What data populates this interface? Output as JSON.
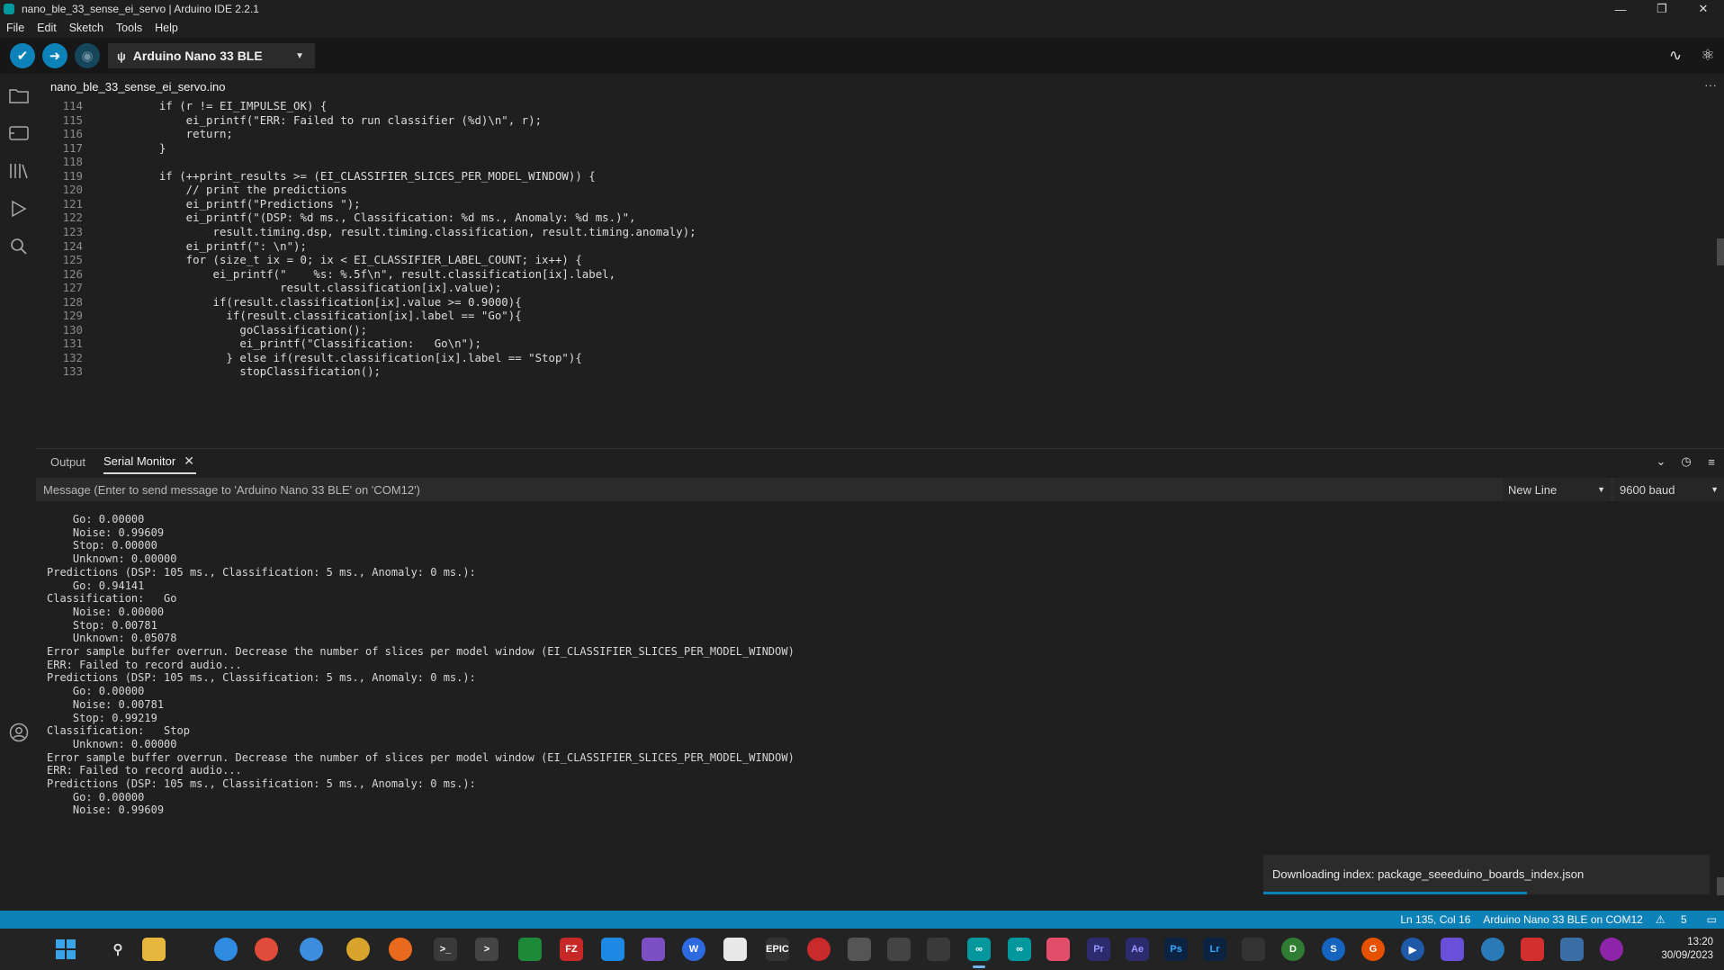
{
  "window": {
    "title": "nano_ble_33_sense_ei_servo | Arduino IDE 2.2.1",
    "controls": [
      "minimize",
      "restore",
      "close"
    ]
  },
  "menu": [
    "File",
    "Edit",
    "Sketch",
    "Tools",
    "Help"
  ],
  "toolbar": {
    "board": "Arduino Nano 33 BLE",
    "buttons": [
      "verify",
      "upload",
      "debug"
    ],
    "right_icons": [
      "serial-plotter",
      "serial-monitor"
    ]
  },
  "sidebar_icons": [
    "sketchbook",
    "boards-manager",
    "library-manager",
    "debug",
    "search",
    "account"
  ],
  "editor": {
    "tab": "nano_ble_33_sense_ei_servo.ino",
    "lines": [
      {
        "n": "114",
        "code": "    if (r != EI_IMPULSE_OK) {"
      },
      {
        "n": "115",
        "code": "        ei_printf(\"ERR: Failed to run classifier (%d)\\n\", r);"
      },
      {
        "n": "116",
        "code": "        return;"
      },
      {
        "n": "117",
        "code": "    }"
      },
      {
        "n": "118",
        "code": ""
      },
      {
        "n": "119",
        "code": "    if (++print_results >= (EI_CLASSIFIER_SLICES_PER_MODEL_WINDOW)) {"
      },
      {
        "n": "120",
        "code": "        // print the predictions"
      },
      {
        "n": "121",
        "code": "        ei_printf(\"Predictions \");"
      },
      {
        "n": "122",
        "code": "        ei_printf(\"(DSP: %d ms., Classification: %d ms., Anomaly: %d ms.)\","
      },
      {
        "n": "123",
        "code": "            result.timing.dsp, result.timing.classification, result.timing.anomaly);"
      },
      {
        "n": "124",
        "code": "        ei_printf(\": \\n\");"
      },
      {
        "n": "125",
        "code": "        for (size_t ix = 0; ix < EI_CLASSIFIER_LABEL_COUNT; ix++) {"
      },
      {
        "n": "126",
        "code": "            ei_printf(\"    %s: %.5f\\n\", result.classification[ix].label,"
      },
      {
        "n": "127",
        "code": "                      result.classification[ix].value);"
      },
      {
        "n": "128",
        "code": "            if(result.classification[ix].value >= 0.9000){"
      },
      {
        "n": "129",
        "code": "              if(result.classification[ix].label == \"Go\"){"
      },
      {
        "n": "130",
        "code": "                goClassification();"
      },
      {
        "n": "131",
        "code": "                ei_printf(\"Classification:   Go\\n\");"
      },
      {
        "n": "132",
        "code": "              } else if(result.classification[ix].label == \"Stop\"){"
      },
      {
        "n": "133",
        "code": "                stopClassification();"
      }
    ]
  },
  "panel": {
    "tabs": [
      "Output",
      "Serial Monitor"
    ],
    "active_tab": "Serial Monitor",
    "message_placeholder": "Message (Enter to send message to 'Arduino Nano 33 BLE' on 'COM12')",
    "line_ending": "New Line",
    "baud": "9600 baud",
    "serial_lines": [
      "    Go: 0.00000",
      "    Noise: 0.99609",
      "    Stop: 0.00000",
      "    Unknown: 0.00000",
      "Predictions (DSP: 105 ms., Classification: 5 ms., Anomaly: 0 ms.):",
      "    Go: 0.94141",
      "Classification:   Go",
      "    Noise: 0.00000",
      "    Stop: 0.00781",
      "    Unknown: 0.05078",
      "Error sample buffer overrun. Decrease the number of slices per model window (EI_CLASSIFIER_SLICES_PER_MODEL_WINDOW)",
      "ERR: Failed to record audio...",
      "Predictions (DSP: 105 ms., Classification: 5 ms., Anomaly: 0 ms.):",
      "    Go: 0.00000",
      "    Noise: 0.00781",
      "    Stop: 0.99219",
      "Classification:   Stop",
      "    Unknown: 0.00000",
      "Error sample buffer overrun. Decrease the number of slices per model window (EI_CLASSIFIER_SLICES_PER_MODEL_WINDOW)",
      "ERR: Failed to record audio...",
      "Predictions (DSP: 105 ms., Classification: 5 ms., Anomaly: 0 ms.):",
      "    Go: 0.00000",
      "    Noise: 0.99609"
    ]
  },
  "notification": {
    "text": "Downloading index: package_seeeduino_boards_index.json",
    "progress": 0.59
  },
  "statusbar": {
    "position": "Ln 135, Col 16",
    "board_port": "Arduino Nano 33 BLE on COM12",
    "notifications": "5"
  },
  "taskbar": {
    "time": "13:20",
    "date": "30/09/2023"
  },
  "colors": {
    "accent": "#0d82b8",
    "background": "#1f1f1f",
    "toolbar": "#171717"
  }
}
